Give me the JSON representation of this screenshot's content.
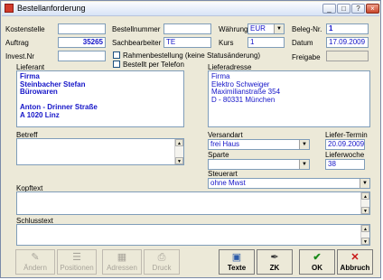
{
  "window": {
    "title": "Bestellanforderung"
  },
  "form": {
    "kostenstelle_label": "Kostenstelle",
    "kostenstelle_value": "",
    "bestellnummer_label": "Bestellnummer",
    "bestellnummer_value": "",
    "waehrung_label": "Währung",
    "waehrung_value": "EUR",
    "belegnr_label": "Beleg-Nr.",
    "belegnr_value": "1",
    "auftrag_label": "Auftrag",
    "auftrag_value": "35265",
    "sachbearbeiter_label": "Sachbearbeiter",
    "sachbearbeiter_value": "TE",
    "kurs_label": "Kurs",
    "kurs_value": "1",
    "datum_label": "Datum",
    "datum_value": "17.09.2009",
    "investnr_label": "Invest.Nr",
    "investnr_value": "",
    "rahmenbestellung_label": "Rahmenbestellung (keine Statusänderung)",
    "telefon_label": "Bestellt per Telefon",
    "freigabe_label": "Freigabe",
    "lieferant_label": "Lieferant",
    "lieferant_lines": [
      "Firma",
      "Steinbacher Stefan",
      "Bürowaren",
      "",
      "Anton - Drinner Straße",
      "A 1020 Linz"
    ],
    "lieferadresse_label": "Lieferadresse",
    "lieferadresse_lines": [
      "Firma",
      "Elektro Schweiger",
      "Maximilianstraße 354",
      "D - 80331 München"
    ],
    "betreff_label": "Betreff",
    "versandart_label": "Versandart",
    "versandart_value": "frei Haus",
    "liefertermin_label": "Liefer-Termin",
    "liefertermin_value": "20.09.2009",
    "sparte_label": "Sparte",
    "sparte_value": "",
    "lieferwoche_label": "Lieferwoche",
    "lieferwoche_value": "38",
    "steuerart_label": "Steuerart",
    "steuerart_value": "ohne Mwst",
    "kopftext_label": "Kopftext",
    "schlusstext_label": "Schlusstext"
  },
  "buttons": {
    "aendern": "Ändern",
    "positionen": "Positionen",
    "adressen": "Adressen",
    "druck": "Druck",
    "texte": "Texte",
    "zk": "ZK",
    "ok": "OK",
    "abbruch": "Abbruch"
  },
  "icons": {
    "window": "app-icon",
    "minimize": "minimize-icon",
    "maximize": "maximize-icon",
    "help": "help-icon",
    "close": "close-icon"
  }
}
